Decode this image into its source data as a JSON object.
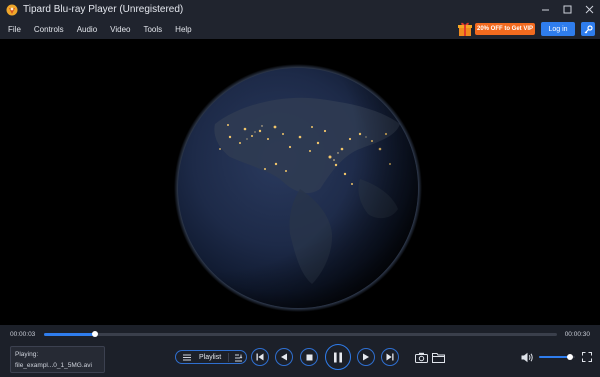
{
  "window": {
    "title": "Tipard Blu-ray Player (Unregistered)"
  },
  "menu": {
    "items": [
      "File",
      "Controls",
      "Audio",
      "Video",
      "Tools",
      "Help"
    ],
    "vip_label": "20% OFF to Get VIP",
    "login_label": "Log in"
  },
  "player": {
    "current_time": "00:00:03",
    "total_time": "00:00:30",
    "progress_fraction": 0.1,
    "volume_fraction": 0.85,
    "now_playing_label": "Playing:",
    "now_playing_file": "file_exampl...0_1_5MG.avi",
    "playlist_label": "Playlist"
  },
  "colors": {
    "accent": "#2f7ded",
    "vip": "#f26a1f",
    "chrome": "#20242e"
  },
  "icons": {
    "app": "tipard-logo-icon",
    "gift": "gift-icon",
    "key": "key-icon",
    "minimize": "minimize-icon",
    "maximize": "maximize-icon",
    "close": "close-icon",
    "playlist": "playlist-icon",
    "sort": "sort-icon",
    "skip_start": "skip-to-start-icon",
    "rewind": "rewind-icon",
    "stop": "stop-icon",
    "pause": "pause-icon",
    "forward": "fast-forward-icon",
    "skip_end": "skip-to-end-icon",
    "snapshot": "camera-icon",
    "folder": "folder-icon",
    "volume": "volume-icon",
    "fullscreen": "fullscreen-icon"
  }
}
